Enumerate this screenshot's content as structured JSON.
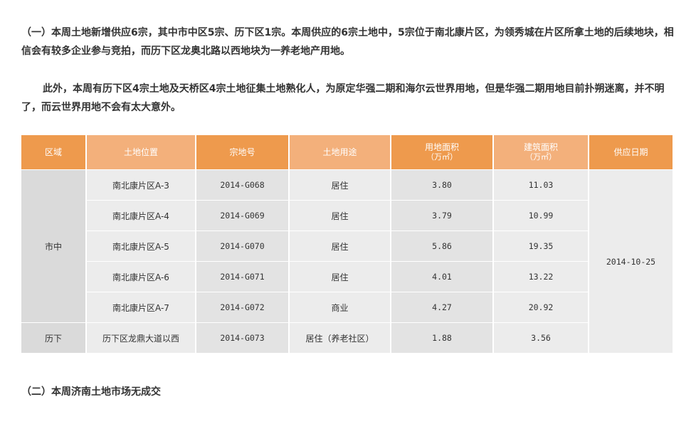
{
  "paragraphs": {
    "p1": "（一）本周土地新增供应6宗，其中市中区5宗、历下区1宗。本周供应的6宗土地中，5宗位于南北康片区，为领秀城在片区所拿土地的后续地块，相信会有较多企业参与竞拍，而历下区龙奥北路以西地块为一养老地产用地。",
    "p2": "此外，本周有历下区4宗土地及天桥区4宗土地征集土地熟化人，为原定华强二期和海尔云世界用地，但是华强二期用地目前扑朔迷离，并不明了，而云世界用地不会有太大意外。",
    "p3": "（二）本周济南土地市场无成交"
  },
  "table": {
    "headers": {
      "region": "区域",
      "location": "土地位置",
      "lot_no": "宗地号",
      "use": "土地用途",
      "land_area": "用地面积",
      "land_area_unit": "（万㎡）",
      "build_area": "建筑面积",
      "build_area_unit": "（万㎡）",
      "date": "供应日期"
    },
    "groups": [
      {
        "region": "市中",
        "rows": 5
      },
      {
        "region": "历下",
        "rows": 1
      }
    ],
    "supply_date": "2014-10-25",
    "rows": [
      {
        "location": "南北康片区A-3",
        "lot_no": "2014-G068",
        "use": "居住",
        "land_area": "3.80",
        "build_area": "11.03"
      },
      {
        "location": "南北康片区A-4",
        "lot_no": "2014-G069",
        "use": "居住",
        "land_area": "3.79",
        "build_area": "10.99"
      },
      {
        "location": "南北康片区A-5",
        "lot_no": "2014-G070",
        "use": "居住",
        "land_area": "5.86",
        "build_area": "19.35"
      },
      {
        "location": "南北康片区A-6",
        "lot_no": "2014-G071",
        "use": "居住",
        "land_area": "4.01",
        "build_area": "13.22"
      },
      {
        "location": "南北康片区A-7",
        "lot_no": "2014-G072",
        "use": "商业",
        "land_area": "4.27",
        "build_area": "20.92"
      },
      {
        "location": "历下区龙鼎大道以西",
        "lot_no": "2014-G073",
        "use": "居住（养老社区）",
        "land_area": "1.88",
        "build_area": "3.56"
      }
    ]
  }
}
